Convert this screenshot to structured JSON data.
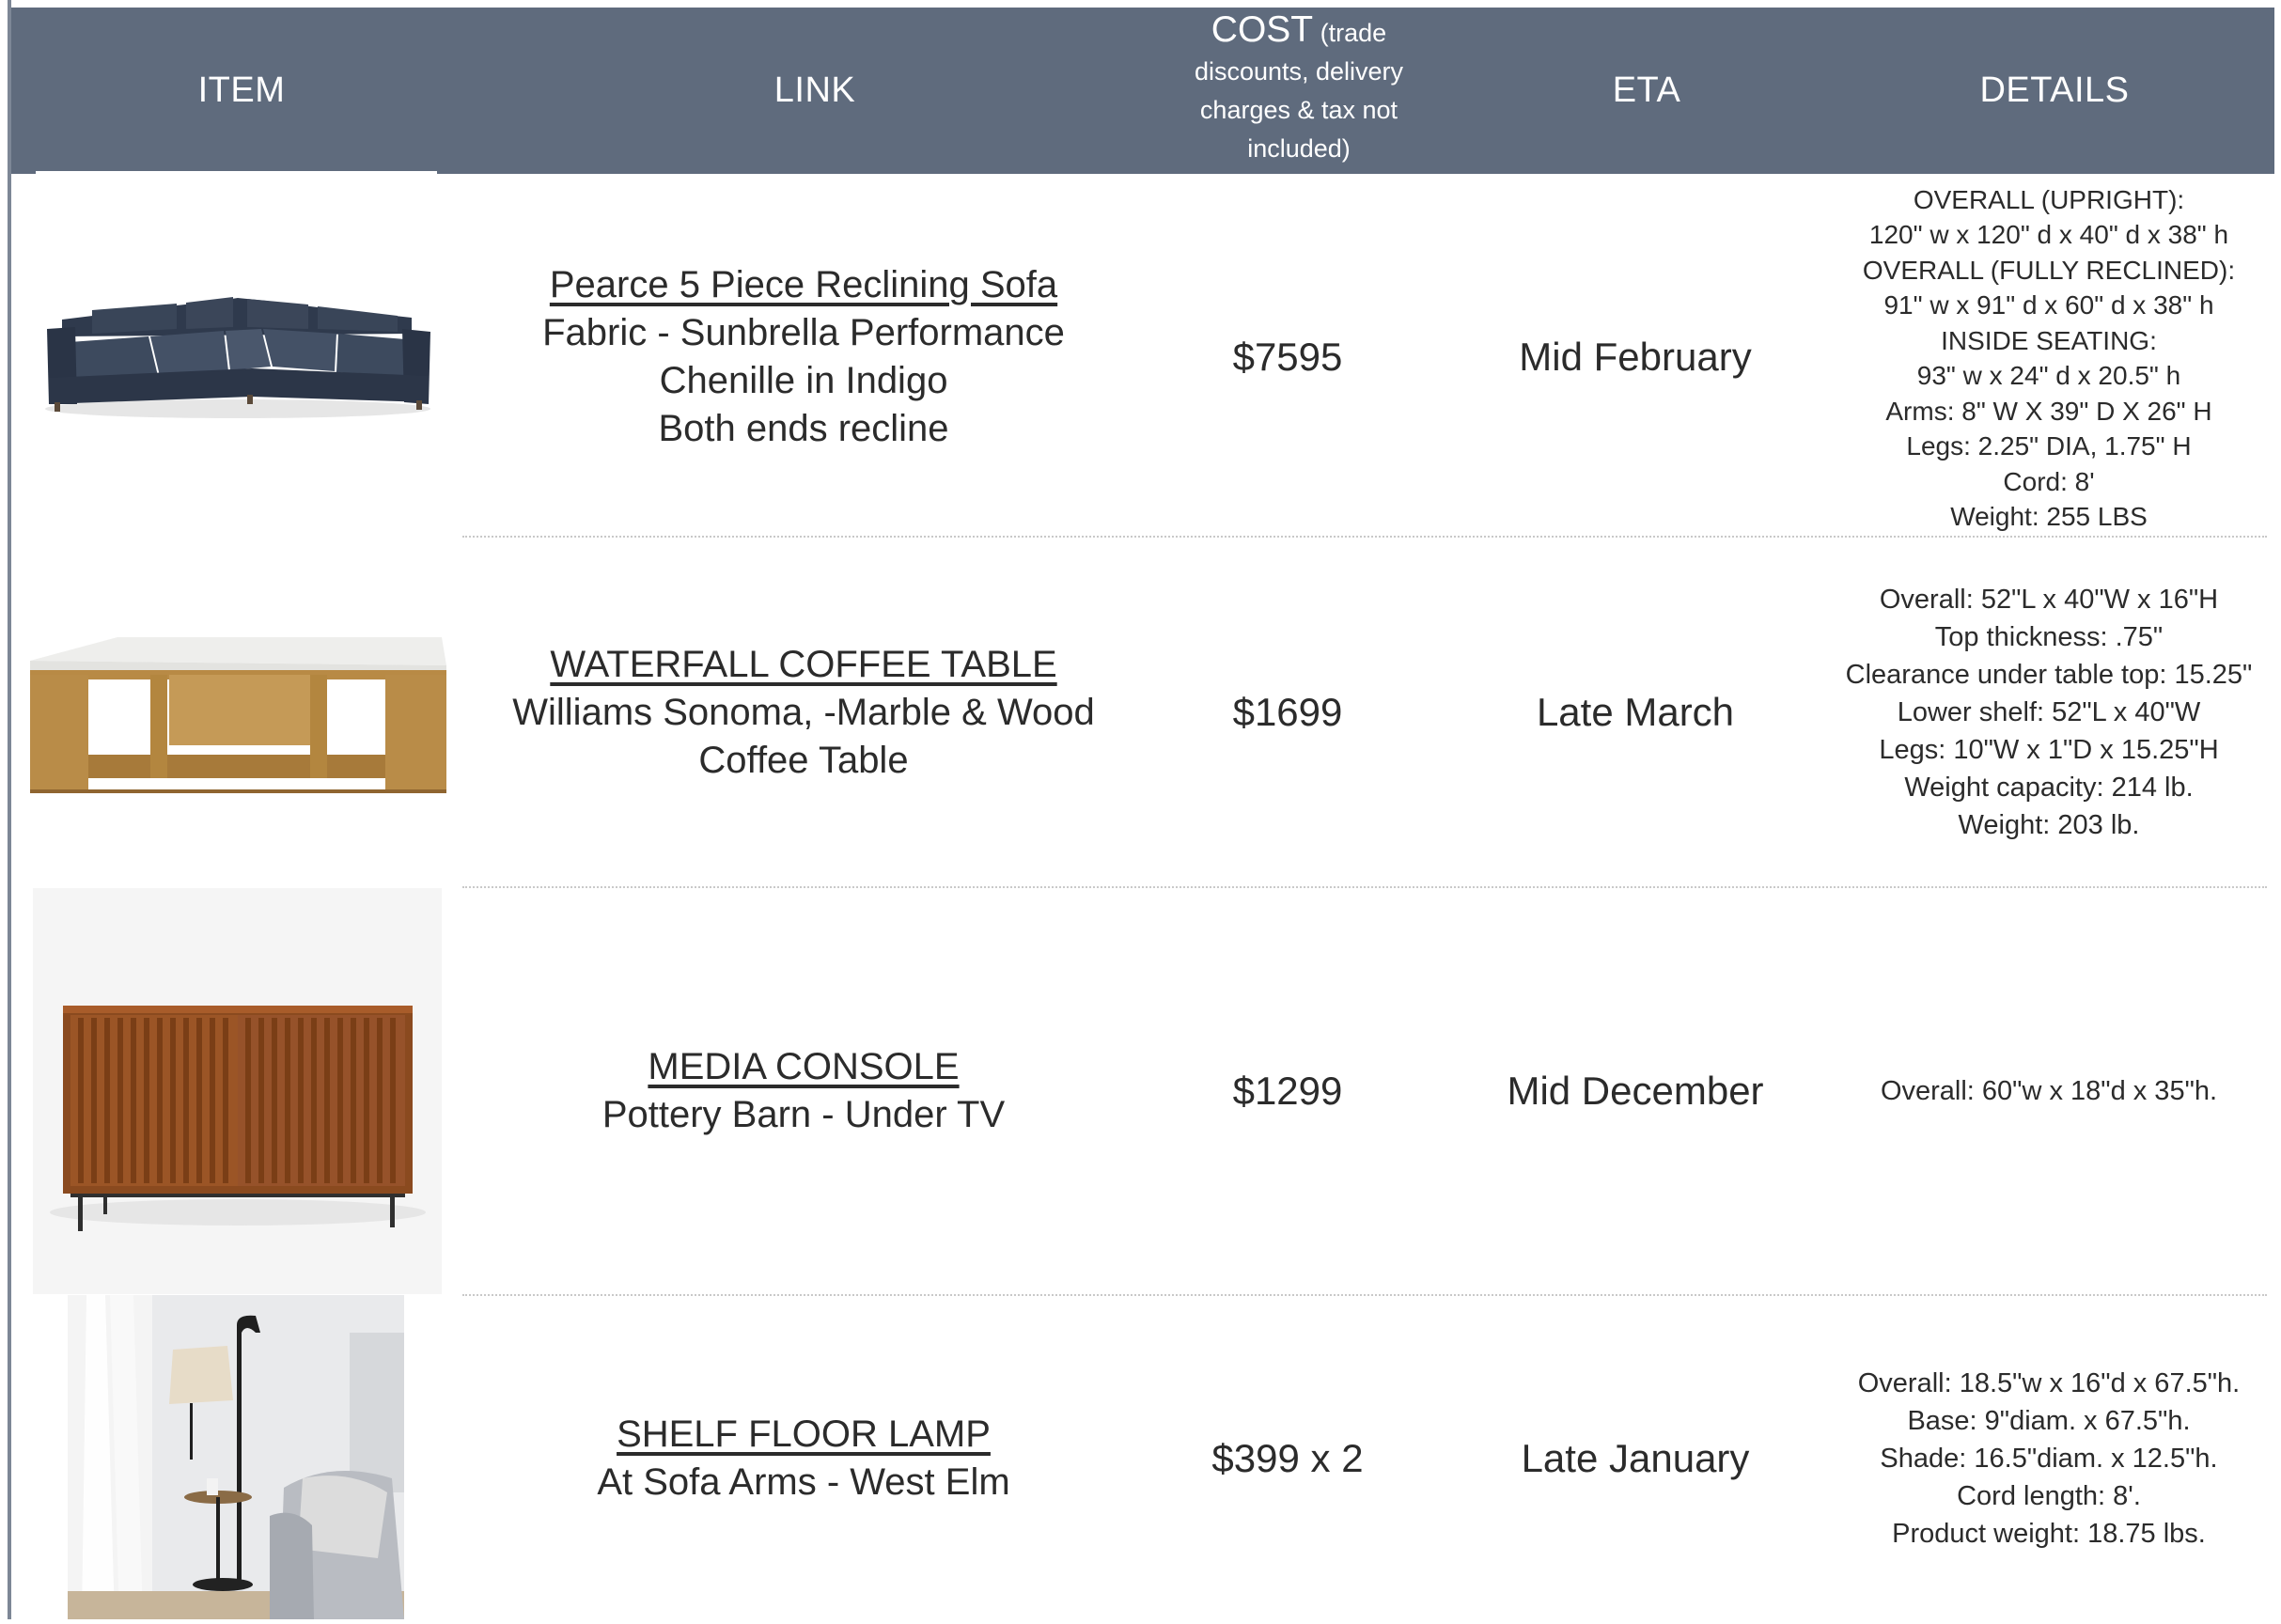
{
  "header": {
    "item": "ITEM",
    "link": "LINK",
    "cost_main": "COST",
    "cost_note_1": " (trade",
    "cost_note_2": "discounts, delivery",
    "cost_note_3": "charges & tax not",
    "cost_note_4": "included)",
    "eta": "ETA",
    "details": "DETAILS"
  },
  "colors": {
    "header_bg": "#5f6b7d",
    "header_text": "#ffffff",
    "body_text": "#2b2b2b"
  },
  "rows": [
    {
      "image": "navy-sectional-sofa-image",
      "link_title": "Pearce 5 Piece Reclining Sofa",
      "link_lines": [
        "Fabric - Sunbrella Performance",
        "Chenille in Indigo",
        "Both ends recline"
      ],
      "cost": "$7595",
      "eta": "Mid February",
      "details": [
        "OVERALL (UPRIGHT):",
        "120\" w x 120\" d x 40\" d x 38\" h",
        "OVERALL (FULLY RECLINED):",
        "91\" w x 91\" d x 60\" d x 38\" h",
        "INSIDE SEATING:",
        "93\" w x 24\" d x 20.5\" h",
        "Arms: 8\" W X 39\" D X 26\" H",
        "Legs: 2.25\" DIA, 1.75\" H",
        "Cord: 8'",
        "Weight: 255 LBS"
      ]
    },
    {
      "image": "marble-wood-coffee-table-image",
      "link_title": "WATERFALL COFFEE TABLE",
      "link_lines": [
        "Williams Sonoma, -Marble & Wood",
        "Coffee Table"
      ],
      "cost": "$1699",
      "eta": "Late March",
      "details": [
        "Overall: 52\"L x 40\"W x 16\"H",
        "Top thickness: .75\"",
        "Clearance under table top: 15.25\"",
        "Lower shelf: 52\"L x 40\"W",
        "Legs: 10\"W x 1\"D x 15.25\"H",
        "Weight capacity: 214 lb.",
        "Weight: 203 lb."
      ]
    },
    {
      "image": "walnut-media-console-image",
      "link_title": "MEDIA CONSOLE",
      "link_lines": [
        "Pottery Barn - Under TV"
      ],
      "cost": "$1299",
      "eta": "Mid December",
      "details": [
        "Overall: 60\"w x 18\"d x 35\"h."
      ]
    },
    {
      "image": "shelf-floor-lamp-image",
      "link_title": "SHELF FLOOR LAMP",
      "link_lines": [
        "At Sofa Arms - West Elm"
      ],
      "cost": "$399 x 2",
      "eta": "Late January",
      "details": [
        "Overall: 18.5\"w x 16\"d x 67.5\"h.",
        "Base: 9\"diam. x 67.5\"h.",
        "Shade: 16.5\"diam. x 12.5\"h.",
        "Cord length: 8'.",
        "Product weight: 18.75 lbs."
      ]
    }
  ]
}
